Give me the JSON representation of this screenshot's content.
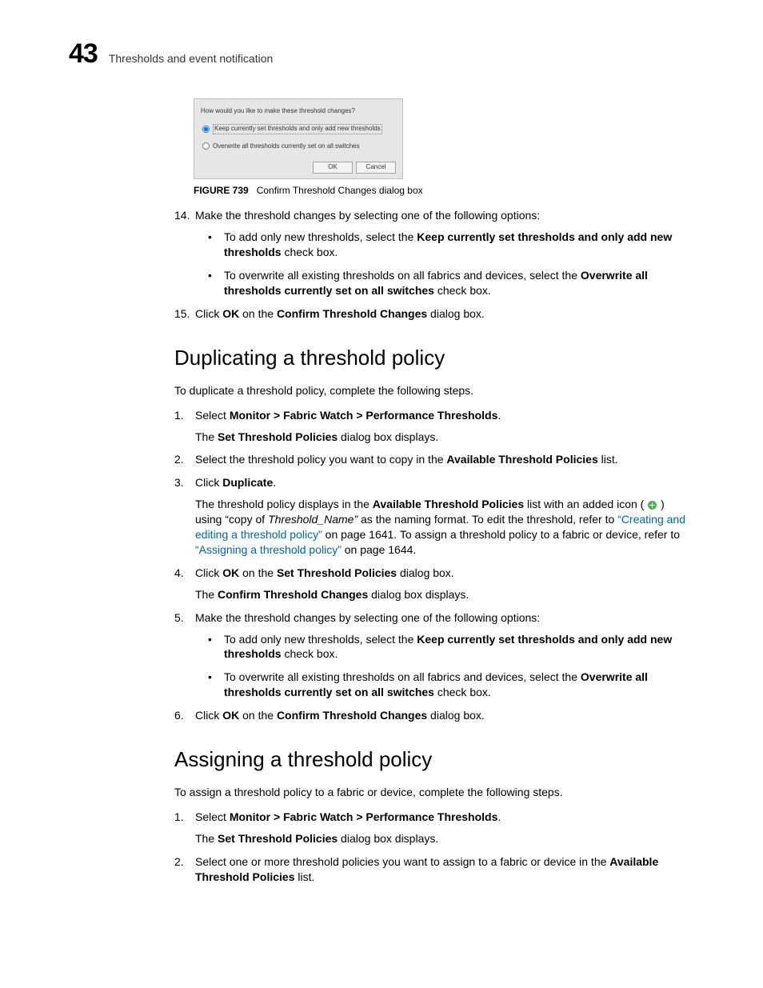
{
  "header": {
    "chapter_number": "43",
    "chapter_title": "Thresholds and event notification"
  },
  "dialog": {
    "question": "How would you like to make these threshold changes?",
    "option1": "Keep currently set thresholds and only add new thresholds",
    "option2": "Overwrite all thresholds currently set on all switches",
    "ok": "OK",
    "cancel": "Cancel"
  },
  "figure": {
    "label": "FIGURE 739",
    "caption": "Confirm Threshold Changes dialog box"
  },
  "steps_a": {
    "s14": {
      "num": "14.",
      "text": "Make the threshold changes by selecting one of the following options:",
      "b1_pre": "To add only new thresholds, select the ",
      "b1_bold": "Keep currently set thresholds and only add new thresholds",
      "b1_post": " check box.",
      "b2_pre": "To overwrite all existing thresholds on all fabrics and devices, select the ",
      "b2_bold": "Overwrite all thresholds currently set on all switches",
      "b2_post": " check box."
    },
    "s15": {
      "num": "15.",
      "pre": "Click ",
      "ok": "OK",
      "mid": " on the ",
      "dlg": "Confirm Threshold Changes",
      "post": " dialog box."
    }
  },
  "section_dup": {
    "title": "Duplicating a threshold policy",
    "intro": "To duplicate a threshold policy, complete the following steps.",
    "s1": {
      "num": "1.",
      "pre": "Select ",
      "path": "Monitor > Fabric Watch > Performance Thresholds",
      "post": ".",
      "sub_pre": "The ",
      "sub_bold": "Set Threshold Policies",
      "sub_post": " dialog box displays."
    },
    "s2": {
      "num": "2.",
      "pre": "Select the threshold policy you want to copy in the ",
      "bold": "Available Threshold Policies",
      "post": " list."
    },
    "s3": {
      "num": "3.",
      "pre": "Click ",
      "bold": "Duplicate",
      "post": ".",
      "sub_pre": "The threshold policy displays in the ",
      "sub_bold": "Available Threshold Policies",
      "sub_mid1": " list with an added icon ( ",
      "sub_mid2": " ) using “copy of ",
      "sub_italic": "Threshold_Name”",
      "sub_mid3": " as the naming format. To edit the threshold, refer to ",
      "link1": "“Creating and editing a threshold policy”",
      "sub_mid4": " on page 1641. To assign a threshold policy to a fabric or device, refer to ",
      "link2": "“Assigning a threshold policy”",
      "sub_post": " on page 1644."
    },
    "s4": {
      "num": "4.",
      "pre": "Click ",
      "ok": "OK",
      "mid": " on the ",
      "dlg": "Set Threshold Policies",
      "post": " dialog box.",
      "sub_pre": "The ",
      "sub_bold": "Confirm Threshold Changes",
      "sub_post": " dialog box displays."
    },
    "s5": {
      "num": "5.",
      "text": "Make the threshold changes by selecting one of the following options:",
      "b1_pre": "To add only new thresholds, select the ",
      "b1_bold": "Keep currently set thresholds and only add new thresholds",
      "b1_post": " check box.",
      "b2_pre": "To overwrite all existing thresholds on all fabrics and devices, select the ",
      "b2_bold": "Overwrite all thresholds currently set on all switches",
      "b2_post": " check box."
    },
    "s6": {
      "num": "6.",
      "pre": "Click ",
      "ok": "OK",
      "mid": " on the ",
      "dlg": "Confirm Threshold Changes",
      "post": " dialog box."
    }
  },
  "section_assign": {
    "title": "Assigning a threshold policy",
    "intro": "To assign a threshold policy to a fabric or device, complete the following steps.",
    "s1": {
      "num": "1.",
      "pre": "Select ",
      "path": "Monitor > Fabric Watch > Performance Thresholds",
      "post": ".",
      "sub_pre": "The ",
      "sub_bold": "Set Threshold Policies",
      "sub_post": " dialog box displays."
    },
    "s2": {
      "num": "2.",
      "pre": "Select one or more threshold policies you want to assign to a fabric or device in the ",
      "bold": "Available Threshold Policies",
      "post": " list."
    }
  }
}
